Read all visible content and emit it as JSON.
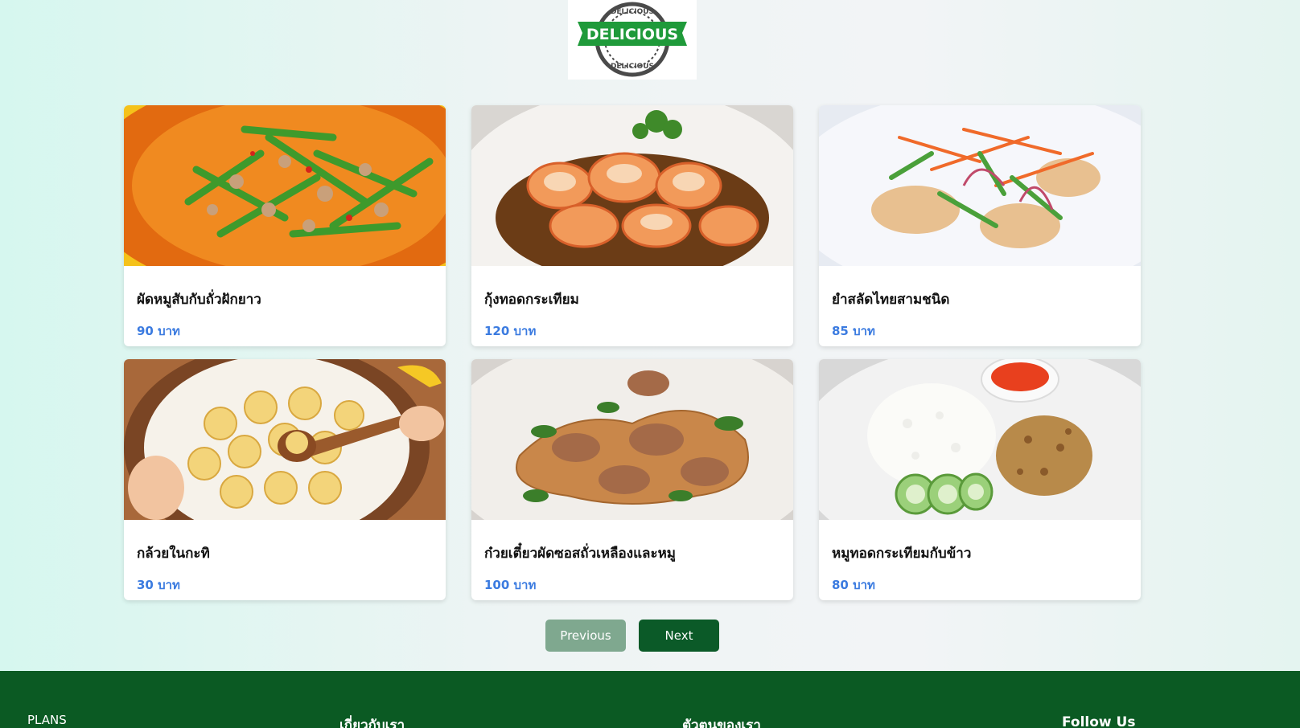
{
  "logo": {
    "text_main": "DELICIOUS",
    "text_ring": "DELICIOUS",
    "colors": {
      "ribbon": "#1f9a3a",
      "stamp": "#4a4a4a"
    }
  },
  "menu": {
    "items": [
      {
        "name": "ผัดหมูสับกับถั่วฝักยาว",
        "price": "90 บาท",
        "image": "stir-fried-pork-long-beans"
      },
      {
        "name": "กุ้งทอดกระเทียม",
        "price": "120 บาท",
        "image": "garlic-fried-shrimp"
      },
      {
        "name": "ยำสลัดไทยสามชนิด",
        "price": "85 บาท",
        "image": "thai-spicy-salad"
      },
      {
        "name": "กล้วยในกะทิ",
        "price": "30 บาท",
        "image": "banana-in-coconut-milk"
      },
      {
        "name": "ก๋วยเตี๋ยวผัดซอสถั่วเหลืองและหมู",
        "price": "100 บาท",
        "image": "pad-see-ew-pork"
      },
      {
        "name": "หมูทอดกระเทียมกับข้าว",
        "price": "80 บาท",
        "image": "garlic-pork-rice"
      }
    ]
  },
  "pagination": {
    "previous_label": "Previous",
    "next_label": "Next"
  },
  "footer": {
    "plans": "PLANS",
    "about": "เกี่ยวกับเรา",
    "agents": "ตัวตนของเรา",
    "follow": "Follow Us"
  },
  "colors": {
    "price": "#3b7be0",
    "footer_bg": "#0b5a23",
    "next_btn": "#0b5a28",
    "prev_btn": "#7fa88f"
  }
}
